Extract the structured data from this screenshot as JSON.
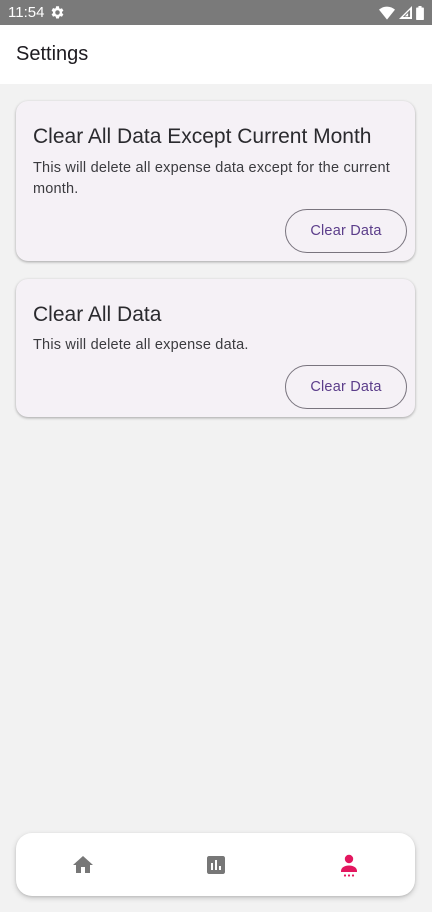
{
  "status_bar": {
    "time": "11:54"
  },
  "app_bar": {
    "title": "Settings"
  },
  "cards": [
    {
      "title": "Clear All Data Except Current Month",
      "description": "This will delete all expense data except for the current month.",
      "button_label": "Clear Data"
    },
    {
      "title": "Clear All Data",
      "description": "This will delete all expense data.",
      "button_label": "Clear Data"
    }
  ],
  "bottom_nav": {
    "items": [
      {
        "icon": "home-icon",
        "selected": false
      },
      {
        "icon": "bar-chart-icon",
        "selected": false
      },
      {
        "icon": "person-icon",
        "selected": true
      }
    ]
  },
  "colors": {
    "accent": "#5b3d8a",
    "nav_selected": "#e3175f",
    "nav_unselected": "#777777",
    "card_background": "#f5f1f6",
    "page_background": "#f2f2f2"
  }
}
